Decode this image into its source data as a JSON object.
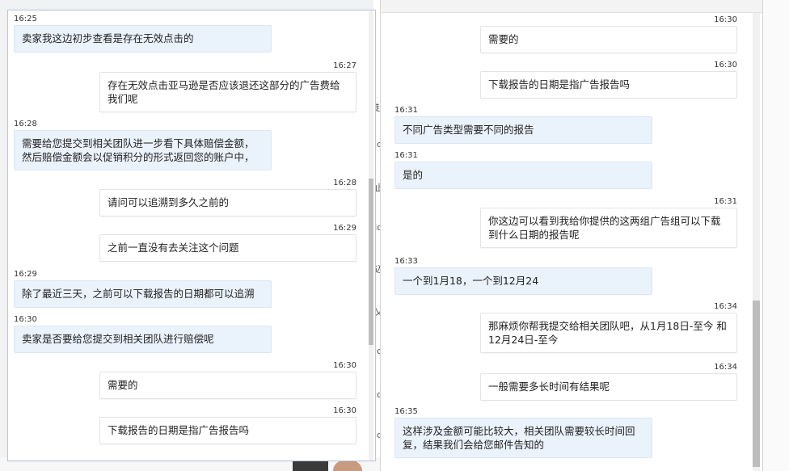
{
  "background": {
    "side_chars": [
      "赴",
      "ic",
      "止",
      "Jo",
      "込",
      "乂",
      "ic",
      "ic",
      "ic"
    ]
  },
  "left_panel": {
    "messages": [
      {
        "dir": "in",
        "time": "16:25",
        "text": "卖家我这边初步查看是存在无效点击的"
      },
      {
        "dir": "out",
        "time": "16:27",
        "text": "存在无效点击亚马逊是否应该退还这部分的广告费给我们呢"
      },
      {
        "dir": "in",
        "time": "16:28",
        "text": "需要给您提交到相关团队进一步看下具体赔偿金额，然后赔偿金额会以促销积分的形式返回您的账户中，"
      },
      {
        "dir": "out",
        "time": "16:28",
        "text": "请问可以追溯到多久之前的"
      },
      {
        "dir": "out",
        "time": "16:29",
        "text": "之前一直没有去关注这个问题"
      },
      {
        "dir": "in",
        "time": "16:29",
        "text": "除了最近三天，之前可以下载报告的日期都可以追溯"
      },
      {
        "dir": "in",
        "time": "16:30",
        "text": "卖家是否要给您提交到相关团队进行赔偿呢"
      },
      {
        "dir": "out",
        "time": "16:30",
        "text": "需要的"
      },
      {
        "dir": "out",
        "time": "16:30",
        "text": "下载报告的日期是指广告报告吗"
      }
    ]
  },
  "right_panel": {
    "messages": [
      {
        "dir": "out",
        "time": "16:30",
        "text": "需要的"
      },
      {
        "dir": "out",
        "time": "16:30",
        "text": "下载报告的日期是指广告报告吗"
      },
      {
        "dir": "in",
        "time": "16:31",
        "text": "不同广告类型需要不同的报告"
      },
      {
        "dir": "in",
        "time": "16:31",
        "text": "是的"
      },
      {
        "dir": "out",
        "time": "16:31",
        "text": "你这边可以看到我给你提供的这两组广告组可以下载到什么日期的报告呢"
      },
      {
        "dir": "in",
        "time": "16:33",
        "text": "一个到1月18，一个到12月24"
      },
      {
        "dir": "out",
        "time": "16:34",
        "text": "那麻烦你帮我提交给相关团队吧，从1月18日-至今 和12月24日-至今"
      },
      {
        "dir": "out",
        "time": "16:34",
        "text": "一般需要多长时间有结果呢"
      },
      {
        "dir": "in",
        "time": "16:35",
        "text": "这样涉及金额可能比较大，相关团队需要较长时间回复，结果我们会给您邮件告知的"
      }
    ]
  }
}
